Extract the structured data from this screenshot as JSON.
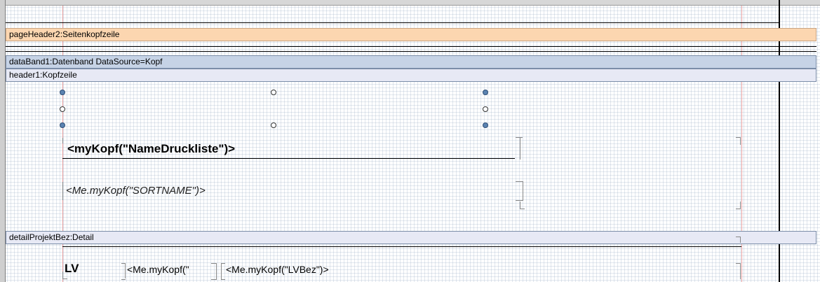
{
  "bands": {
    "page_header": "pageHeader2:Seitenkopfzeile",
    "data_band": "dataBand1:Datenband DataSource=Kopf",
    "header": "header1:Kopfzeile",
    "detail": "detailProjektBez:Detail"
  },
  "fields": {
    "name_druckliste": "<myKopf(\"NameDruckliste\")>",
    "sortname": "<Me.myKopf(\"SORTNAME\")>",
    "lv_label": "LV",
    "lv_kopf": "<Me.myKopf(\"",
    "lv_bez": "<Me.myKopf(\"LVBez\")>"
  },
  "colors": {
    "page_header_band": "#fcd6b0",
    "data_band": "#c6d3e6",
    "header_band": "#e7e9f5",
    "selection_handle": "#5b83b1"
  }
}
